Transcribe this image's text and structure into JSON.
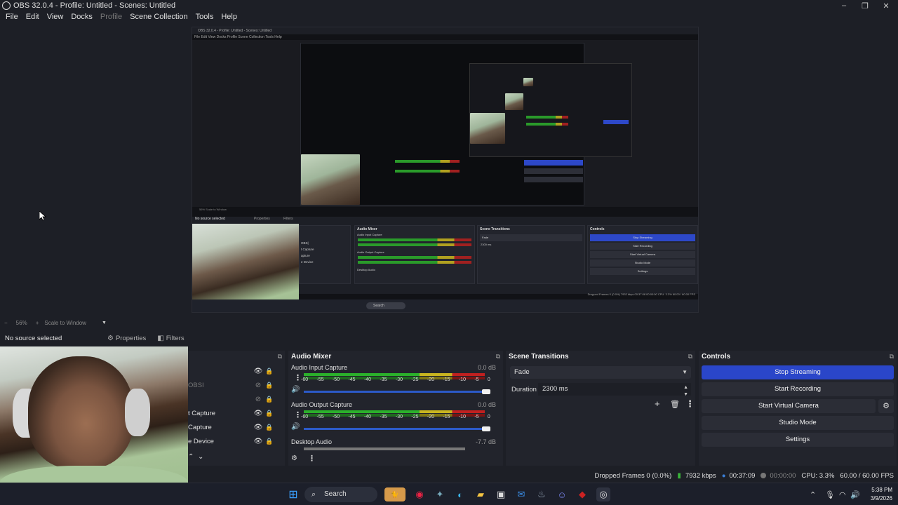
{
  "window": {
    "title": "OBS 32.0.4 - Profile: Untitled - Scenes: Untitled",
    "controls": [
      "–",
      "❐",
      "✕"
    ]
  },
  "menu": [
    "File",
    "Edit",
    "View",
    "Docks",
    "Profile",
    "Scene Collection",
    "Tools",
    "Help"
  ],
  "nested": {
    "title": "OBS 32.0.4 - Profile: Untitled - Scenes: Untitled",
    "menu": "File  Edit  View  Docks  Profile  Scene Collection  Tools  Help",
    "no_source": "No source selected",
    "properties": "Properties",
    "filters": "Filters",
    "zoom": "56%   Scale to Window",
    "audio_mixer": "Audio Mixer",
    "scene_transitions": "Scene Transitions",
    "controls": "Controls",
    "audio_input": "Audio Input Capture",
    "audio_output": "Audio Output Capture",
    "desktop_audio": "Desktop Audio",
    "fade": "Fade",
    "duration": "Duration",
    "duration_value": "2300 ms",
    "stop_streaming": "Stop Streaming",
    "start_recording": "Start Recording",
    "start_virtual_camera": "Start Virtual Camera",
    "studio_mode": "Studio Mode",
    "settings": "Settings",
    "status": "Dropped Frames 0 (0.0%)   7932 kbps   00:37:08   00:00:00   CPU: 3.3%   60.00 / 60.00 FPS",
    "search": "Search",
    "src_items": [
      "OBS|",
      "t Capture",
      "apture",
      "e Device"
    ]
  },
  "preview_toolbar": {
    "zoom": "56%",
    "scale_mode": "Scale to Window",
    "minus": "−",
    "plus": "+"
  },
  "source_toolbar": {
    "no_source": "No source selected",
    "properties": "Properties",
    "filters": "Filters"
  },
  "sources": {
    "items": [
      {
        "name": "OBSI",
        "visible_icon": "eye-hidden-icon"
      },
      {
        "name": "",
        "visible_icon": "eye-hidden-icon"
      },
      {
        "name": "t Capture",
        "visible_icon": "eye-icon"
      },
      {
        "name": "Capture",
        "visible_icon": "eye-icon"
      },
      {
        "name": "e Device",
        "visible_icon": "eye-icon"
      }
    ]
  },
  "mixer": {
    "title": "Audio Mixer",
    "channels": [
      {
        "name": "Audio Input Capture",
        "db": "0.0 dB",
        "level": 1.0
      },
      {
        "name": "Audio Output Capture",
        "db": "0.0 dB",
        "level": 1.0
      },
      {
        "name": "Desktop Audio",
        "db": "-7.7 dB",
        "level": 0.82
      }
    ],
    "ticks": [
      "-60",
      "-55",
      "-50",
      "-45",
      "-40",
      "-35",
      "-30",
      "-25",
      "-20",
      "-15",
      "-10",
      "-5",
      "0"
    ]
  },
  "transitions": {
    "title": "Scene Transitions",
    "selected": "Fade",
    "duration_label": "Duration",
    "duration_value": "2300 ms"
  },
  "controls": {
    "title": "Controls",
    "stop_streaming": "Stop Streaming",
    "start_recording": "Start Recording",
    "start_virtual_camera": "Start Virtual Camera",
    "studio_mode": "Studio Mode",
    "settings": "Settings"
  },
  "status": {
    "dropped_frames": "Dropped Frames 0 (0.0%)",
    "bitrate": "7932 kbps",
    "stream_time": "00:37:09",
    "record_time": "00:00:00",
    "cpu": "CPU: 3.3%",
    "fps": "60.00 / 60.00 FPS"
  },
  "taskbar": {
    "search": "Search",
    "time": "5:38 PM",
    "date": "3/9/2026"
  },
  "colors": {
    "accent_blue": "#2a46c9",
    "meter_green": "#2bb02b",
    "meter_yellow": "#c8b420",
    "meter_red": "#c02020"
  }
}
